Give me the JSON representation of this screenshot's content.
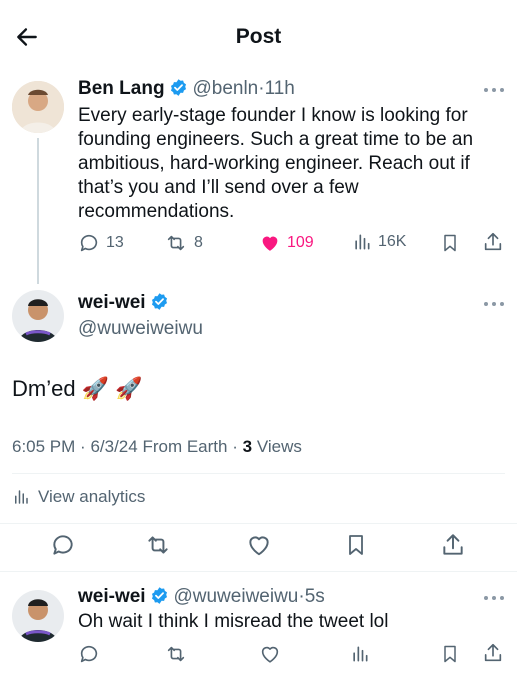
{
  "header": {
    "title": "Post"
  },
  "parent_post": {
    "name": "Ben Lang",
    "handle": "@benln",
    "sep": "·",
    "time": "11h",
    "text": "Every early-stage founder I know is looking for founding engineers. Such a great time to be an ambitious, hard-working engineer. Reach out if that’s you and I’ll send over a few recommendations.",
    "replies": "13",
    "reposts": "8",
    "likes": "109",
    "views": "16K",
    "colors": {
      "like": "#f91880",
      "verified": "#1d9bf0"
    }
  },
  "main_post": {
    "name": "wei-wei",
    "handle": "@wuweiweiwu",
    "text": "Dm’ed",
    "emoji": "🚀 🚀",
    "time": "6:05 PM",
    "date": "6/3/24",
    "source": "From Earth",
    "views_count": "3",
    "views_label": "Views",
    "analytics_label": "View analytics"
  },
  "reply_post": {
    "name": "wei-wei",
    "handle": "@wuweiweiwu",
    "time": "5s",
    "text": "Oh wait I think I misread the tweet lol"
  }
}
